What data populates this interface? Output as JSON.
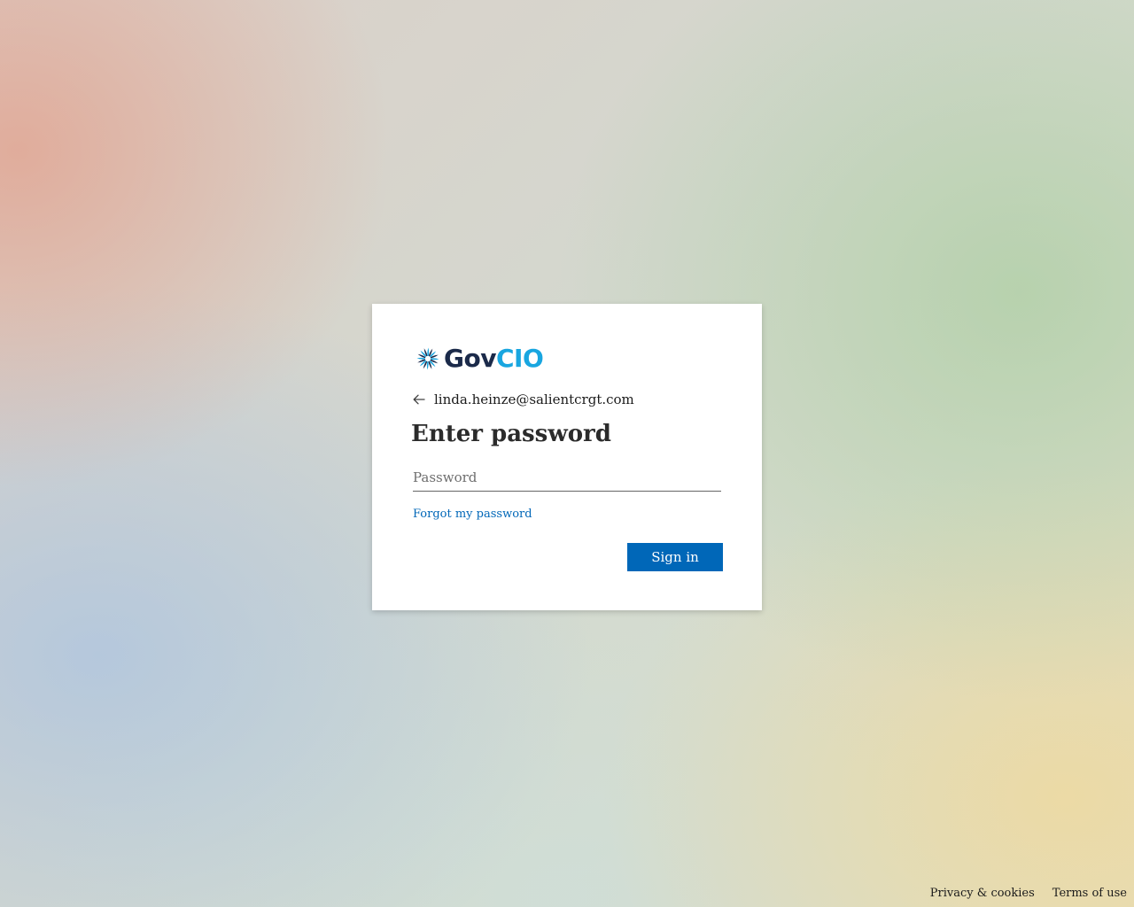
{
  "brand": {
    "logo_part1": "Gov",
    "logo_part2": "CIO",
    "logo_icon": "pinwheel-logo-icon",
    "colors": {
      "navy": "#1b2a4a",
      "cyan": "#19a6e0"
    }
  },
  "identity": {
    "back_icon": "arrow-left-icon",
    "email": "linda.heinze@salientcrgt.com"
  },
  "form": {
    "title": "Enter password",
    "password_placeholder": "Password",
    "password_value": "",
    "forgot_link": "Forgot my password",
    "signin_label": "Sign in"
  },
  "footer": {
    "privacy": "Privacy & cookies",
    "terms": "Terms of use"
  },
  "colors": {
    "accent": "#0067b8",
    "card_bg": "#ffffff"
  }
}
